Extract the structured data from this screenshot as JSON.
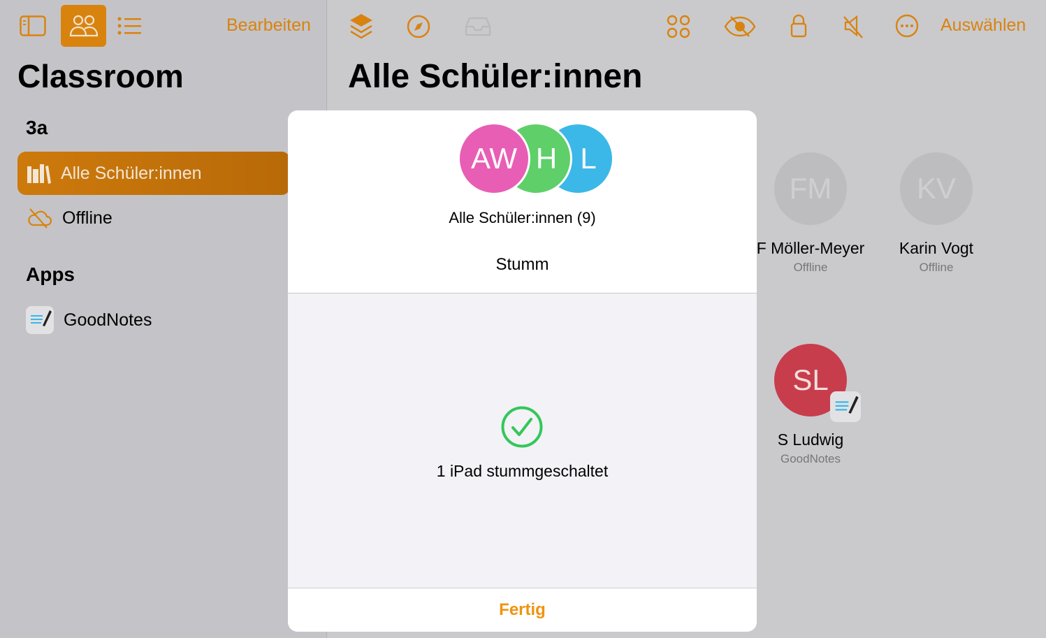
{
  "sidebar": {
    "edit_label": "Bearbeiten",
    "title": "Classroom",
    "group": "3a",
    "items": [
      {
        "label": "Alle Schüler:innen",
        "icon": "books-icon",
        "selected": true
      },
      {
        "label": "Offline",
        "icon": "cloud-slash-icon"
      }
    ],
    "apps_header": "Apps",
    "apps": [
      {
        "label": "GoodNotes",
        "icon": "goodnotes-icon"
      }
    ]
  },
  "toolbar": {
    "select_label": "Auswählen",
    "icons": [
      "layers-icon",
      "compass-icon",
      "tray-icon",
      "apps-grid-icon",
      "eye-slash-icon",
      "lock-icon",
      "speaker-mute-icon",
      "more-icon"
    ]
  },
  "main": {
    "title": "Alle Schüler:innen",
    "students": [
      {
        "initials": "FM",
        "name": "F Möller-Meyer",
        "status": "Offline",
        "color": "#bdbdc0"
      },
      {
        "initials": "KV",
        "name": "Karin Vogt",
        "status": "Offline",
        "color": "#bdbdc0"
      },
      {
        "initials": "SL",
        "name": "S Ludwig",
        "status": "GoodNotes",
        "color": "#c83d4c"
      }
    ]
  },
  "dialog": {
    "avatars": [
      {
        "initials": "AW",
        "color": "#e85eb5"
      },
      {
        "initials": "H",
        "color": "#5fcf6a"
      },
      {
        "initials": "L",
        "color": "#3bb8e8"
      }
    ],
    "group_label": "Alle Schüler:innen (9)",
    "action": "Stumm",
    "result": "1 iPad stummgeschaltet",
    "done_label": "Fertig",
    "accent": "#f0930f",
    "success_color": "#34c759"
  }
}
